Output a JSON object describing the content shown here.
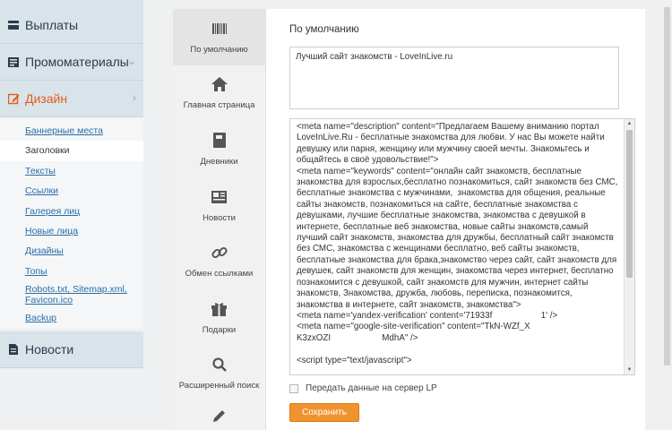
{
  "sidebar": {
    "payouts": "Выплаты",
    "promo": "Промоматериалы",
    "design": "Дизайн",
    "news": "Новости",
    "design_items": [
      "Баннерные места",
      "Заголовки",
      "Тексты",
      "Ссылки",
      "Галерея лиц",
      "Новые лица",
      "Дизайны",
      "Топы",
      "Robots.txt, Sitemap.xml,",
      "Favicon.ico",
      "Backup"
    ]
  },
  "tabs": [
    "По умолчанию",
    "Главная страница",
    "Дневники",
    "Новости",
    "Обмен ссылками",
    "Подарки",
    "Расширенный поиск"
  ],
  "icons": {
    "payouts": "card-icon",
    "promo": "newspaper-icon",
    "design": "pencil-square-icon",
    "news": "document-icon"
  },
  "content": {
    "section_title": "По умолчанию",
    "title_value": "Лучший сайт знакомств - LoveInLive.ru",
    "meta_value": "<meta name=\"description\" content=\"Предлагаем Вашему вниманию портал LoveInLive.Ru - бесплатные знакомства для любви. У нас Вы можете найти девушку или парня, женщину или мужчину своей мечты. Знакомьтесь и общайтесь в своё удовольствие!\">\n<meta name=\"keywords\" content=\"онлайн сайт знакомств, бесплатные знакомства для взрослых,бесплатно познакомиться, сайт знакомств без СМС, бесплатные знакомства с мужчинами,  знакомства для общения, реальные сайты знакомств, познакомиться на сайте, бесплатные знакомства с девушками, лучшие бесплатные знакомства, знакомства с девушкой в интернете, бесплатные веб знакомства, новые сайты знакомств,самый лучший сайт знакомств, знакомства для дружбы, бесплатный сайт знакомств без СМС, знакомства с женщинами бесплатно, веб сайты знакомств, бесплатные знакомства для брака,знакомство через сайт, сайт знакомств для девушек, сайт знакомств для женщин, знакомства через интернет, бесплатно познакомится с девушкой, сайт знакомств для мужчин, интернет сайты знакомств, Знакомства, дружба, любовь, переписка, познакомится, знакомства в интернете, сайт знакомств, знакомства\">\n<meta name='yandex-verification' content='71933f                    1' />\n<meta name=\"google-site-verification\" content=\"TkN-WZf_X                         K3zxOZI                     MdhA\" />\n\n<script type=\"text/javascript\">",
    "checkbox_label": "Передать данные на сервер LP",
    "save_label": "Сохранить"
  },
  "colors": {
    "accent": "#f0932f",
    "active_nav": "#e05d1c",
    "link": "#2b6ea8"
  }
}
